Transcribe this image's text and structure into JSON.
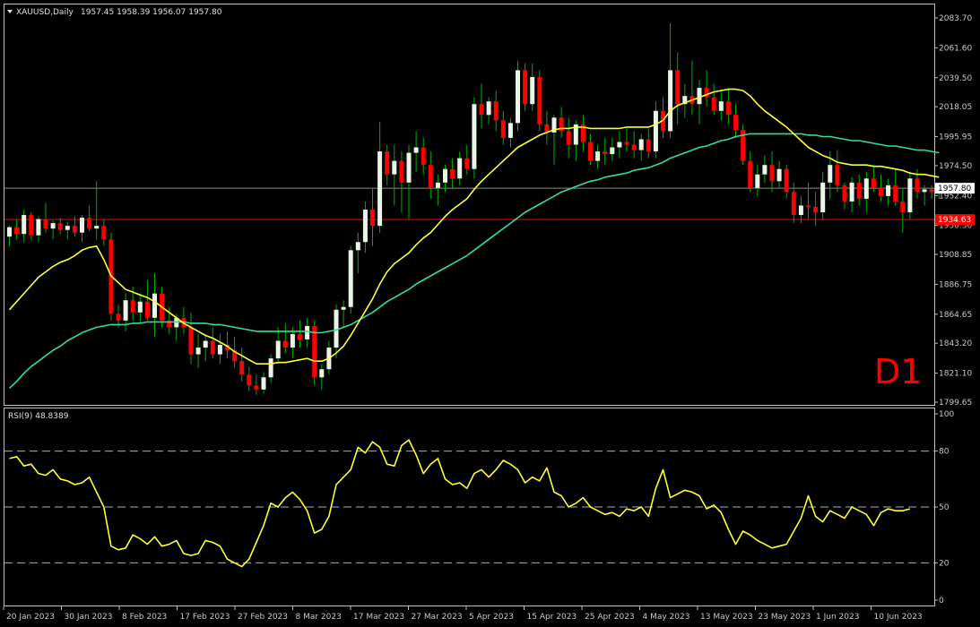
{
  "header": {
    "symbol": "XAUUSD,Daily",
    "ohlc": "1957.45 1958.39 1956.07 1957.80"
  },
  "timeframe_label": "D1",
  "colors": {
    "background": "#000000",
    "bull_candle": "#e8f5e8",
    "bear_candle": "#ff0000",
    "wick": "#00b000",
    "ma_fast": "#ffff33",
    "ma_slow": "#33dd99",
    "rsi": "#ffff33",
    "bid_line": "#8c8c8c",
    "level_line": "#ff0000",
    "timeframe_text": "#ff0000",
    "axis_text": "#c8c8c8"
  },
  "price_axis": {
    "ticks": [
      "2083.70",
      "2061.60",
      "2039.50",
      "2018.05",
      "1995.95",
      "1974.50",
      "1952.40",
      "1930.30",
      "1908.85",
      "1886.75",
      "1864.65",
      "1843.20",
      "1821.10",
      "1799.65"
    ]
  },
  "price_tags": {
    "bid": "1957.80",
    "level": "1934.63"
  },
  "rsi_panel": {
    "label": "RSI(9) 48.8389",
    "ticks": [
      "100",
      "80",
      "50",
      "20",
      "0"
    ]
  },
  "x_axis": {
    "ticks": [
      "20 Jan 2023",
      "30 Jan 2023",
      "8 Feb 2023",
      "17 Feb 2023",
      "27 Feb 2023",
      "8 Mar 2023",
      "17 Mar 2023",
      "27 Mar 2023",
      "5 Apr 2023",
      "15 Apr 2023",
      "25 Apr 2023",
      "4 May 2023",
      "13 May 2023",
      "23 May 2023",
      "1 Jun 2023",
      "10 Jun 2023"
    ]
  },
  "chart_data": {
    "type": "candlestick",
    "symbol": "XAUUSD",
    "timeframe": "Daily",
    "price_range": [
      1799.65,
      2083.7
    ],
    "levels": {
      "bid": 1957.8,
      "horizontal_line": 1934.63
    },
    "candles": [
      [
        1922,
        1930,
        1915,
        1929
      ],
      [
        1929,
        1935,
        1920,
        1924
      ],
      [
        1924,
        1942,
        1918,
        1938
      ],
      [
        1938,
        1940,
        1920,
        1923
      ],
      [
        1923,
        1937,
        1918,
        1935
      ],
      [
        1935,
        1947,
        1925,
        1928
      ],
      [
        1928,
        1934,
        1920,
        1932
      ],
      [
        1932,
        1936,
        1924,
        1927
      ],
      [
        1927,
        1933,
        1920,
        1930
      ],
      [
        1930,
        1937,
        1922,
        1925
      ],
      [
        1925,
        1938,
        1918,
        1936
      ],
      [
        1936,
        1945,
        1926,
        1928
      ],
      [
        1928,
        1963,
        1920,
        1930
      ],
      [
        1930,
        1935,
        1915,
        1920
      ],
      [
        1920,
        1925,
        1860,
        1865
      ],
      [
        1865,
        1872,
        1855,
        1860
      ],
      [
        1860,
        1880,
        1852,
        1875
      ],
      [
        1875,
        1885,
        1860,
        1866
      ],
      [
        1866,
        1880,
        1858,
        1874
      ],
      [
        1874,
        1890,
        1860,
        1862
      ],
      [
        1862,
        1895,
        1848,
        1880
      ],
      [
        1880,
        1885,
        1855,
        1860
      ],
      [
        1860,
        1870,
        1850,
        1855
      ],
      [
        1855,
        1865,
        1845,
        1862
      ],
      [
        1862,
        1870,
        1850,
        1855
      ],
      [
        1855,
        1866,
        1828,
        1835
      ],
      [
        1835,
        1850,
        1825,
        1840
      ],
      [
        1840,
        1850,
        1830,
        1845
      ],
      [
        1845,
        1855,
        1832,
        1835
      ],
      [
        1835,
        1850,
        1828,
        1842
      ],
      [
        1842,
        1852,
        1832,
        1838
      ],
      [
        1838,
        1848,
        1825,
        1830
      ],
      [
        1830,
        1840,
        1815,
        1820
      ],
      [
        1820,
        1826,
        1808,
        1812
      ],
      [
        1812,
        1820,
        1805,
        1809
      ],
      [
        1809,
        1822,
        1806,
        1818
      ],
      [
        1818,
        1835,
        1814,
        1832
      ],
      [
        1832,
        1855,
        1828,
        1845
      ],
      [
        1845,
        1858,
        1836,
        1840
      ],
      [
        1840,
        1855,
        1832,
        1850
      ],
      [
        1850,
        1860,
        1840,
        1846
      ],
      [
        1846,
        1862,
        1840,
        1856
      ],
      [
        1856,
        1860,
        1812,
        1818
      ],
      [
        1818,
        1828,
        1809,
        1824
      ],
      [
        1824,
        1845,
        1820,
        1840
      ],
      [
        1840,
        1872,
        1832,
        1868
      ],
      [
        1868,
        1875,
        1855,
        1870
      ],
      [
        1870,
        1915,
        1865,
        1912
      ],
      [
        1912,
        1925,
        1895,
        1918
      ],
      [
        1918,
        1948,
        1910,
        1942
      ],
      [
        1942,
        1958,
        1915,
        1930
      ],
      [
        1930,
        2007,
        1925,
        1985
      ],
      [
        1985,
        1990,
        1960,
        1968
      ],
      [
        1968,
        1990,
        1945,
        1978
      ],
      [
        1978,
        1985,
        1940,
        1962
      ],
      [
        1962,
        1990,
        1935,
        1984
      ],
      [
        1984,
        2000,
        1970,
        1988
      ],
      [
        1988,
        1995,
        1968,
        1975
      ],
      [
        1975,
        1985,
        1950,
        1958
      ],
      [
        1958,
        1968,
        1945,
        1962
      ],
      [
        1962,
        1975,
        1955,
        1972
      ],
      [
        1972,
        1980,
        1958,
        1965
      ],
      [
        1965,
        1985,
        1960,
        1980
      ],
      [
        1980,
        1990,
        1968,
        1972
      ],
      [
        1972,
        2025,
        1965,
        2020
      ],
      [
        2020,
        2035,
        2002,
        2012
      ],
      [
        2012,
        2025,
        2005,
        2022
      ],
      [
        2022,
        2030,
        2000,
        2008
      ],
      [
        2008,
        2015,
        1990,
        1995
      ],
      [
        1995,
        2010,
        1988,
        2006
      ],
      [
        2006,
        2052,
        2000,
        2045
      ],
      [
        2045,
        2050,
        2015,
        2020
      ],
      [
        2020,
        2050,
        2015,
        2040
      ],
      [
        2040,
        2045,
        2000,
        2005
      ],
      [
        2005,
        2015,
        1990,
        1999
      ],
      [
        1999,
        2012,
        1975,
        2010
      ],
      [
        2010,
        2018,
        1995,
        2000
      ],
      [
        2000,
        2010,
        1980,
        1990
      ],
      [
        1990,
        2008,
        1978,
        2005
      ],
      [
        2005,
        2012,
        1985,
        1992
      ],
      [
        1992,
        1998,
        1975,
        1978
      ],
      [
        1978,
        1990,
        1972,
        1985
      ],
      [
        1985,
        1995,
        1975,
        1983
      ],
      [
        1983,
        1995,
        1978,
        1988
      ],
      [
        1988,
        2000,
        1980,
        1992
      ],
      [
        1992,
        2002,
        1985,
        1990
      ],
      [
        1990,
        2000,
        1980,
        1986
      ],
      [
        1986,
        1998,
        1978,
        1994
      ],
      [
        1994,
        2002,
        1980,
        1985
      ],
      [
        1985,
        2022,
        1980,
        2015
      ],
      [
        2015,
        2025,
        1995,
        2000
      ],
      [
        2000,
        2080,
        1995,
        2045
      ],
      [
        2045,
        2058,
        2005,
        2020
      ],
      [
        2020,
        2035,
        2010,
        2026
      ],
      [
        2026,
        2052,
        2012,
        2020
      ],
      [
        2020,
        2038,
        2005,
        2032
      ],
      [
        2032,
        2045,
        2018,
        2025
      ],
      [
        2025,
        2035,
        2012,
        2015
      ],
      [
        2015,
        2030,
        2008,
        2022
      ],
      [
        2022,
        2032,
        2005,
        2012
      ],
      [
        2012,
        2020,
        1995,
        2001
      ],
      [
        2001,
        2005,
        1975,
        1978
      ],
      [
        1978,
        1985,
        1955,
        1958
      ],
      [
        1958,
        1975,
        1952,
        1968
      ],
      [
        1968,
        1982,
        1962,
        1975
      ],
      [
        1975,
        1985,
        1955,
        1963
      ],
      [
        1963,
        1978,
        1958,
        1972
      ],
      [
        1972,
        1975,
        1950,
        1955
      ],
      [
        1955,
        1962,
        1932,
        1938
      ],
      [
        1938,
        1952,
        1932,
        1945
      ],
      [
        1945,
        1962,
        1935,
        1944
      ],
      [
        1944,
        1955,
        1930,
        1940
      ],
      [
        1940,
        1970,
        1934,
        1962
      ],
      [
        1962,
        1985,
        1950,
        1975
      ],
      [
        1975,
        1986,
        1955,
        1960
      ],
      [
        1960,
        1962,
        1942,
        1948
      ],
      [
        1948,
        1966,
        1940,
        1962
      ],
      [
        1962,
        1968,
        1945,
        1950
      ],
      [
        1950,
        1970,
        1940,
        1965
      ],
      [
        1965,
        1975,
        1955,
        1958
      ],
      [
        1958,
        1968,
        1948,
        1952
      ],
      [
        1952,
        1965,
        1945,
        1960
      ],
      [
        1960,
        1972,
        1945,
        1948
      ],
      [
        1948,
        1958,
        1925,
        1940
      ],
      [
        1940,
        1970,
        1935,
        1965
      ],
      [
        1965,
        1972,
        1950,
        1955
      ],
      [
        1955,
        1960,
        1945,
        1957
      ],
      [
        1957,
        1960,
        1950,
        1955
      ],
      [
        1955,
        1962,
        1950,
        1957.8
      ]
    ],
    "ma_fast": [
      1868,
      1874,
      1880,
      1886,
      1892,
      1896,
      1900,
      1903,
      1905,
      1908,
      1912,
      1914,
      1915,
      1905,
      1893,
      1888,
      1883,
      1881,
      1879,
      1877,
      1874,
      1870,
      1866,
      1862,
      1858,
      1855,
      1852,
      1849,
      1847,
      1844,
      1841,
      1837,
      1834,
      1831,
      1828,
      1828,
      1828,
      1829,
      1829,
      1830,
      1831,
      1832,
      1830,
      1830,
      1832,
      1836,
      1841,
      1849,
      1858,
      1867,
      1876,
      1887,
      1896,
      1902,
      1906,
      1910,
      1916,
      1921,
      1925,
      1931,
      1937,
      1942,
      1946,
      1950,
      1957,
      1963,
      1968,
      1973,
      1978,
      1983,
      1988,
      1991,
      1994,
      1997,
      1999,
      2001,
      2002,
      2002,
      2003,
      2003,
      2002,
      2002,
      2002,
      2002,
      2002,
      2003,
      2003,
      2003,
      2003,
      2005,
      2008,
      2015,
      2019,
      2021,
      2023,
      2025,
      2027,
      2029,
      2030,
      2031,
      2031,
      2030,
      2026,
      2020,
      2015,
      2011,
      2007,
      2003,
      1998,
      1993,
      1988,
      1985,
      1982,
      1980,
      1977,
      1976,
      1975,
      1975,
      1975,
      1974,
      1974,
      1973,
      1972,
      1971,
      1969,
      1968,
      1968,
      1967,
      1966
    ],
    "ma_slow": [
      1810,
      1815,
      1821,
      1826,
      1830,
      1834,
      1838,
      1841,
      1845,
      1848,
      1851,
      1853,
      1855,
      1856,
      1857,
      1857,
      1857,
      1858,
      1858,
      1859,
      1859,
      1859,
      1859,
      1859,
      1859,
      1858,
      1858,
      1858,
      1857,
      1857,
      1856,
      1855,
      1854,
      1853,
      1852,
      1852,
      1852,
      1852,
      1852,
      1852,
      1852,
      1852,
      1851,
      1851,
      1852,
      1853,
      1855,
      1857,
      1860,
      1863,
      1866,
      1870,
      1874,
      1877,
      1880,
      1883,
      1887,
      1890,
      1893,
      1896,
      1899,
      1902,
      1905,
      1908,
      1912,
      1916,
      1920,
      1924,
      1928,
      1932,
      1936,
      1940,
      1943,
      1946,
      1949,
      1952,
      1955,
      1957,
      1959,
      1961,
      1963,
      1964,
      1966,
      1967,
      1968,
      1969,
      1971,
      1972,
      1973,
      1975,
      1977,
      1980,
      1982,
      1984,
      1986,
      1988,
      1989,
      1991,
      1993,
      1994,
      1996,
      1997,
      1998,
      1998,
      1998,
      1998,
      1998,
      1998,
      1998,
      1998,
      1997,
      1997,
      1996,
      1996,
      1995,
      1994,
      1993,
      1993,
      1992,
      1991,
      1990,
      1989,
      1989,
      1988,
      1987,
      1986,
      1986,
      1985,
      1984
    ],
    "rsi": {
      "label": "RSI(9) 48.8389",
      "period": 9,
      "range": [
        0,
        100
      ],
      "levels": [
        20,
        50,
        80
      ],
      "values": [
        76,
        77,
        72,
        73,
        68,
        67,
        70,
        65,
        64,
        62,
        63,
        66,
        58,
        50,
        29,
        27,
        28,
        35,
        33,
        30,
        34,
        29,
        30,
        32,
        25,
        24,
        25,
        32,
        31,
        29,
        22,
        20,
        18,
        22,
        31,
        40,
        52,
        50,
        55,
        58,
        54,
        48,
        36,
        38,
        45,
        62,
        66,
        70,
        82,
        79,
        85,
        82,
        73,
        72,
        83,
        86,
        78,
        68,
        73,
        76,
        65,
        62,
        63,
        60,
        68,
        70,
        66,
        70,
        75,
        73,
        70,
        63,
        66,
        64,
        71,
        58,
        56,
        50,
        52,
        55,
        50,
        48,
        46,
        47,
        45,
        49,
        48,
        50,
        45,
        60,
        70,
        55,
        57,
        59,
        58,
        56,
        49,
        51,
        47,
        38,
        30,
        37,
        35,
        32,
        30,
        28,
        29,
        30,
        37,
        44,
        56,
        45,
        42,
        48,
        46,
        44,
        50,
        48,
        46,
        40,
        47,
        49,
        48,
        48,
        49
      ]
    }
  }
}
